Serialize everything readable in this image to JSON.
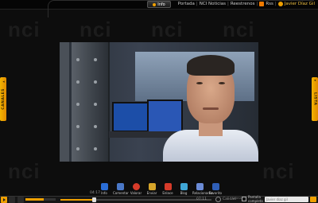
{
  "header": {
    "info_label": "Info",
    "links": [
      "Portada",
      "NCI Noticias",
      "Reestrenos"
    ],
    "rss_label": "Rss",
    "user_name": "Javier Díaz Gil"
  },
  "side_tabs": {
    "left_label": "CANALES",
    "right_label": "LISTA"
  },
  "watermark_text": "nci",
  "toolbar": {
    "items": [
      {
        "label": "Info",
        "icon": "info-icon"
      },
      {
        "label": "Comentar",
        "icon": "comment-icon"
      },
      {
        "label": "Valorar",
        "icon": "rate-icon"
      },
      {
        "label": "Enviar",
        "icon": "send-icon"
      },
      {
        "label": "Enlace",
        "icon": "link-icon"
      },
      {
        "label": "Blog",
        "icon": "blog-icon"
      },
      {
        "label": "Relacionados",
        "icon": "related-icon"
      },
      {
        "label": "Favorito",
        "icon": "favorite-icon"
      }
    ]
  },
  "player": {
    "elapsed": "04:17",
    "duration": "07:11",
    "seek_progress": 0.22,
    "volume": 0.6,
    "calidad_label": "Calidad",
    "quality_value": "Normal",
    "fullscreen_label_1": "Pantalla",
    "fullscreen_label_2": "completa",
    "search_placeholder": "Javier díaz gil"
  },
  "colors": {
    "accent": "#f0a000",
    "background": "#0d0d0d"
  }
}
